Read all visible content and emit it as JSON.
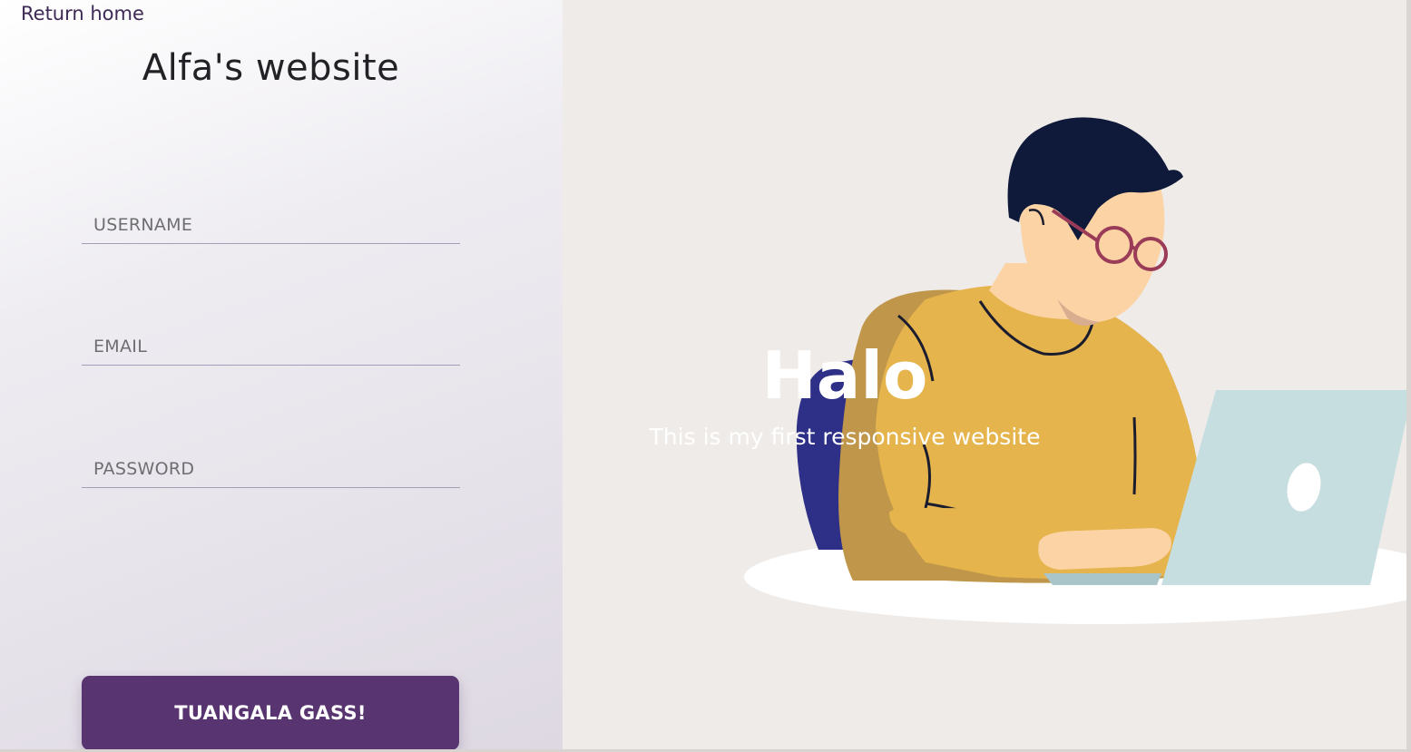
{
  "nav": {
    "return_home": "Return home"
  },
  "form": {
    "title": "Alfa's website",
    "username_placeholder": "USERNAME",
    "email_placeholder": "EMAIL",
    "password_placeholder": "PASSWORD",
    "submit_label": "TUANGALA GASS!"
  },
  "hero": {
    "heading": "Halo",
    "subheading": "This is my first responsive website"
  },
  "colors": {
    "accent": "#583470",
    "hero_background": "#efebe8",
    "sweater": "#e5b44c",
    "hair": "#0f1a3a",
    "glasses": "#9a3b58",
    "laptop": "#c6dee0",
    "chair": "#2e2f86"
  },
  "icons": {
    "illustration": "person-with-laptop-illustration"
  }
}
